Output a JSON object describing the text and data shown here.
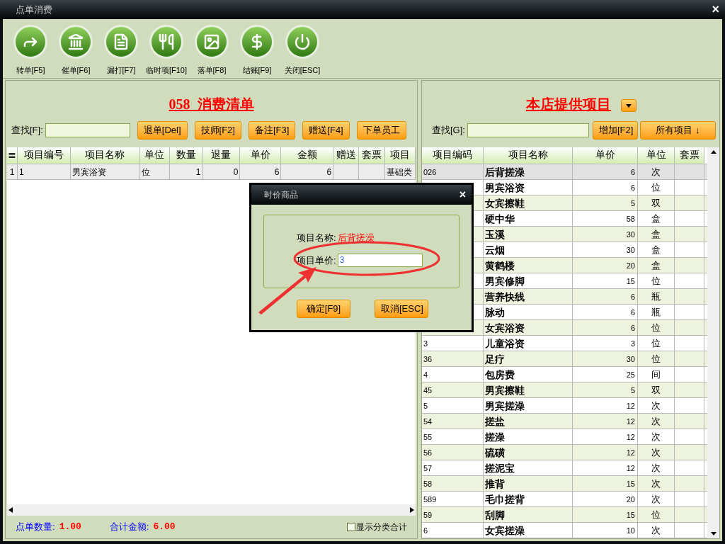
{
  "window": {
    "title": "点单消费",
    "close": "×"
  },
  "toolbar": [
    {
      "kind": "transfer",
      "label": "转单[F5]"
    },
    {
      "kind": "urge",
      "label": "催单[F6]"
    },
    {
      "kind": "print",
      "label": "漏打[F7]"
    },
    {
      "kind": "temp",
      "label": "临时项[F10]"
    },
    {
      "kind": "drop",
      "label": "落单[F8]"
    },
    {
      "kind": "checkout",
      "label": "结账[F9]"
    },
    {
      "kind": "close",
      "label": "关闭[ESC]"
    }
  ],
  "order_panel": {
    "title": "058  消费清单",
    "search_label": "查找[F]:",
    "buttons": [
      "退单[Del]",
      "技师[F2]",
      "备注[F3]",
      "赠送[F4]",
      "下单员工"
    ],
    "columns": [
      "≣",
      "项目编号",
      "项目名称",
      "单位",
      "数量",
      "退量",
      "单价",
      "金额",
      "赠送",
      "套票",
      "项目"
    ],
    "rows": [
      {
        "selected": true,
        "index": "1",
        "code": "1",
        "name": "男宾浴资",
        "unit": "位",
        "qty": "1",
        "returned": "0",
        "price": "6",
        "amount": "6",
        "category": "基础类"
      }
    ],
    "count_label": "点单数量:",
    "count": "1.00",
    "total_label": "合计金额:",
    "total": "6.00",
    "show_category_totals": {
      "label": "显示分类合计",
      "checked": false
    }
  },
  "items_panel": {
    "title": "本店提供项目",
    "search_label": "查找[G]:",
    "add_button": "增加[F2]",
    "filter_button": "所有项目 ↓",
    "columns": [
      "项目编码",
      "项目名称",
      "单价",
      "单位",
      "套票"
    ],
    "rows": [
      {
        "selected": true,
        "code": "026",
        "name": "后背搓澡",
        "price": "6",
        "unit": "次"
      },
      {
        "selected": false,
        "name": "男宾浴资",
        "price": "6",
        "unit": "位"
      },
      {
        "selected": false,
        "name": "女宾擦鞋",
        "price": "5",
        "unit": "双"
      },
      {
        "selected": false,
        "name": "硬中华",
        "price": "58",
        "unit": "盒"
      },
      {
        "selected": false,
        "name": "玉溪",
        "price": "30",
        "unit": "盒"
      },
      {
        "selected": false,
        "name": "云烟",
        "price": "30",
        "unit": "盒"
      },
      {
        "selected": false,
        "name": "黄鹤楼",
        "price": "20",
        "unit": "盒"
      },
      {
        "selected": false,
        "name": "男宾修脚",
        "price": "15",
        "unit": "位"
      },
      {
        "selected": false,
        "name": "营养快线",
        "price": "6",
        "unit": "瓶"
      },
      {
        "selected": false,
        "name": "脉动",
        "price": "6",
        "unit": "瓶"
      },
      {
        "selected": false,
        "name": "女宾浴资",
        "price": "6",
        "unit": "位"
      },
      {
        "selected": false,
        "code": "3",
        "name": "儿童浴资",
        "price": "3",
        "unit": "位"
      },
      {
        "selected": false,
        "code": "36",
        "name": "足疗",
        "price": "30",
        "unit": "位"
      },
      {
        "selected": false,
        "code": "4",
        "name": "包房费",
        "price": "25",
        "unit": "间"
      },
      {
        "selected": false,
        "code": "45",
        "name": "男宾擦鞋",
        "price": "5",
        "unit": "双"
      },
      {
        "selected": false,
        "code": "5",
        "name": "男宾搓澡",
        "price": "12",
        "unit": "次"
      },
      {
        "selected": false,
        "code": "54",
        "name": "搓盐",
        "price": "12",
        "unit": "次"
      },
      {
        "selected": false,
        "code": "55",
        "name": "搓澡",
        "price": "12",
        "unit": "次"
      },
      {
        "selected": false,
        "code": "56",
        "name": "硫磺",
        "price": "12",
        "unit": "次"
      },
      {
        "selected": false,
        "code": "57",
        "name": "搓泥宝",
        "price": "12",
        "unit": "次"
      },
      {
        "selected": false,
        "code": "58",
        "name": "推背",
        "price": "15",
        "unit": "次"
      },
      {
        "selected": false,
        "code": "589",
        "name": "毛巾搓背",
        "price": "20",
        "unit": "次"
      },
      {
        "selected": false,
        "code": "59",
        "name": "刮脚",
        "price": "15",
        "unit": "位"
      },
      {
        "selected": false,
        "code": "6",
        "name": "女宾搓澡",
        "price": "10",
        "unit": "次"
      }
    ]
  },
  "dialog": {
    "title": "时价商品",
    "close": "×",
    "name_label": "项目名称:",
    "name_value": "后背搓澡",
    "price_label": "项目单价:",
    "price_value": "3",
    "buttons": [
      "确定[F9]",
      "取消[ESC]"
    ]
  }
}
